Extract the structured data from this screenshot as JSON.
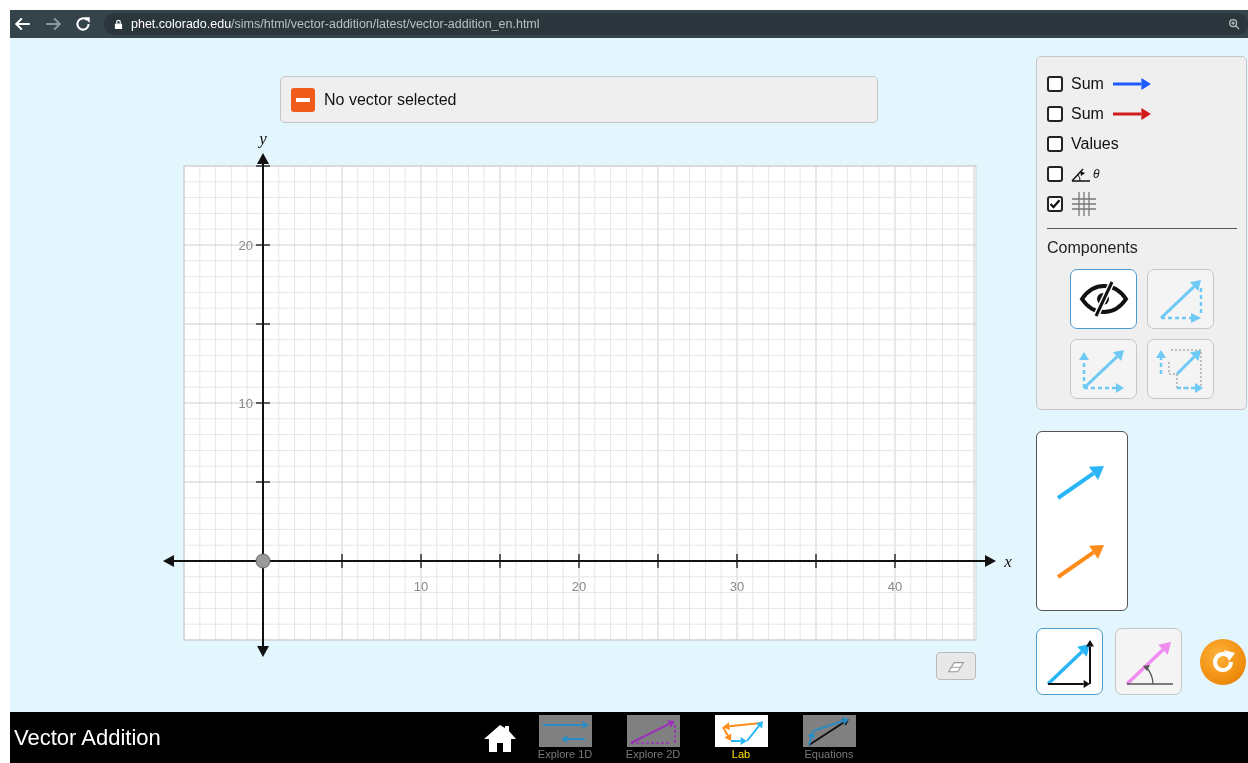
{
  "browser": {
    "url_host": "phet.colorado.edu",
    "url_path": "/sims/html/vector-addition/latest/vector-addition_en.html"
  },
  "selection_panel": {
    "text": "No vector selected"
  },
  "graph": {
    "x_label": "x",
    "y_label": "y",
    "x_tick_labels": [
      "10",
      "20",
      "30",
      "40"
    ],
    "y_tick_labels": [
      "20",
      "10"
    ]
  },
  "options": [
    {
      "kind": "sum",
      "label": "Sum",
      "color": "#1e5bff",
      "checked": false
    },
    {
      "kind": "sum",
      "label": "Sum",
      "color": "#d11b1b",
      "checked": false
    },
    {
      "kind": "text",
      "label": "Values",
      "checked": false
    },
    {
      "kind": "angle",
      "label": "θ",
      "checked": false
    },
    {
      "kind": "grid",
      "checked": true
    }
  ],
  "components": {
    "title": "Components",
    "options": [
      {
        "kind": "hidden",
        "selected": true
      },
      {
        "kind": "triangle",
        "selected": false
      },
      {
        "kind": "parallelogram",
        "selected": false
      },
      {
        "kind": "projection",
        "selected": false
      }
    ]
  },
  "vector_creator": [
    {
      "color": "#29b6f6"
    },
    {
      "color": "#ff8c1a"
    }
  ],
  "coordinate_modes": [
    {
      "kind": "cartesian",
      "selected": true
    },
    {
      "kind": "polar",
      "selected": false
    }
  ],
  "sim_title": "Vector Addition",
  "screens": [
    {
      "kind": "explore1d",
      "label": "Explore 1D",
      "selected": false
    },
    {
      "kind": "explore2d",
      "label": "Explore 2D",
      "selected": false
    },
    {
      "kind": "lab",
      "label": "Lab",
      "selected": true
    },
    {
      "kind": "equations",
      "label": "Equations",
      "selected": false
    }
  ]
}
